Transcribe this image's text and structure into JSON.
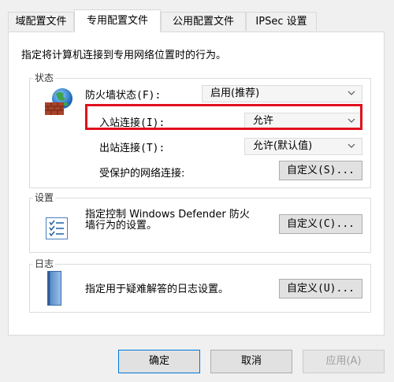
{
  "tabs": [
    {
      "label": "域配置文件"
    },
    {
      "label": "专用配置文件"
    },
    {
      "label": "公用配置文件"
    },
    {
      "label": "IPSec 设置"
    }
  ],
  "panel": {
    "description": "指定将计算机连接到专用网络位置时的行为。",
    "state": {
      "title": "状态",
      "firewall_state_label": "防火墙状态(F):",
      "firewall_state_value": "启用(推荐)",
      "inbound_label": "入站连接(I):",
      "inbound_value": "允许",
      "outbound_label": "出站连接(T):",
      "outbound_value": "允许(默认值)",
      "protected_label": "受保护的网络连接:",
      "protected_button": "自定义(S)..."
    },
    "settings": {
      "title": "设置",
      "desc_line1": "指定控制 Windows Defender 防火",
      "desc_line2": "墙行为的设置。",
      "button": "自定义(C)..."
    },
    "logging": {
      "title": "日志",
      "desc": "指定用于疑难解答的日志设置。",
      "button": "自定义(U)..."
    }
  },
  "footer": {
    "ok": "确定",
    "cancel": "取消",
    "apply": "应用(A)"
  },
  "colors": {
    "highlight": "#e0101c",
    "default_button_border": "#0078d7"
  }
}
